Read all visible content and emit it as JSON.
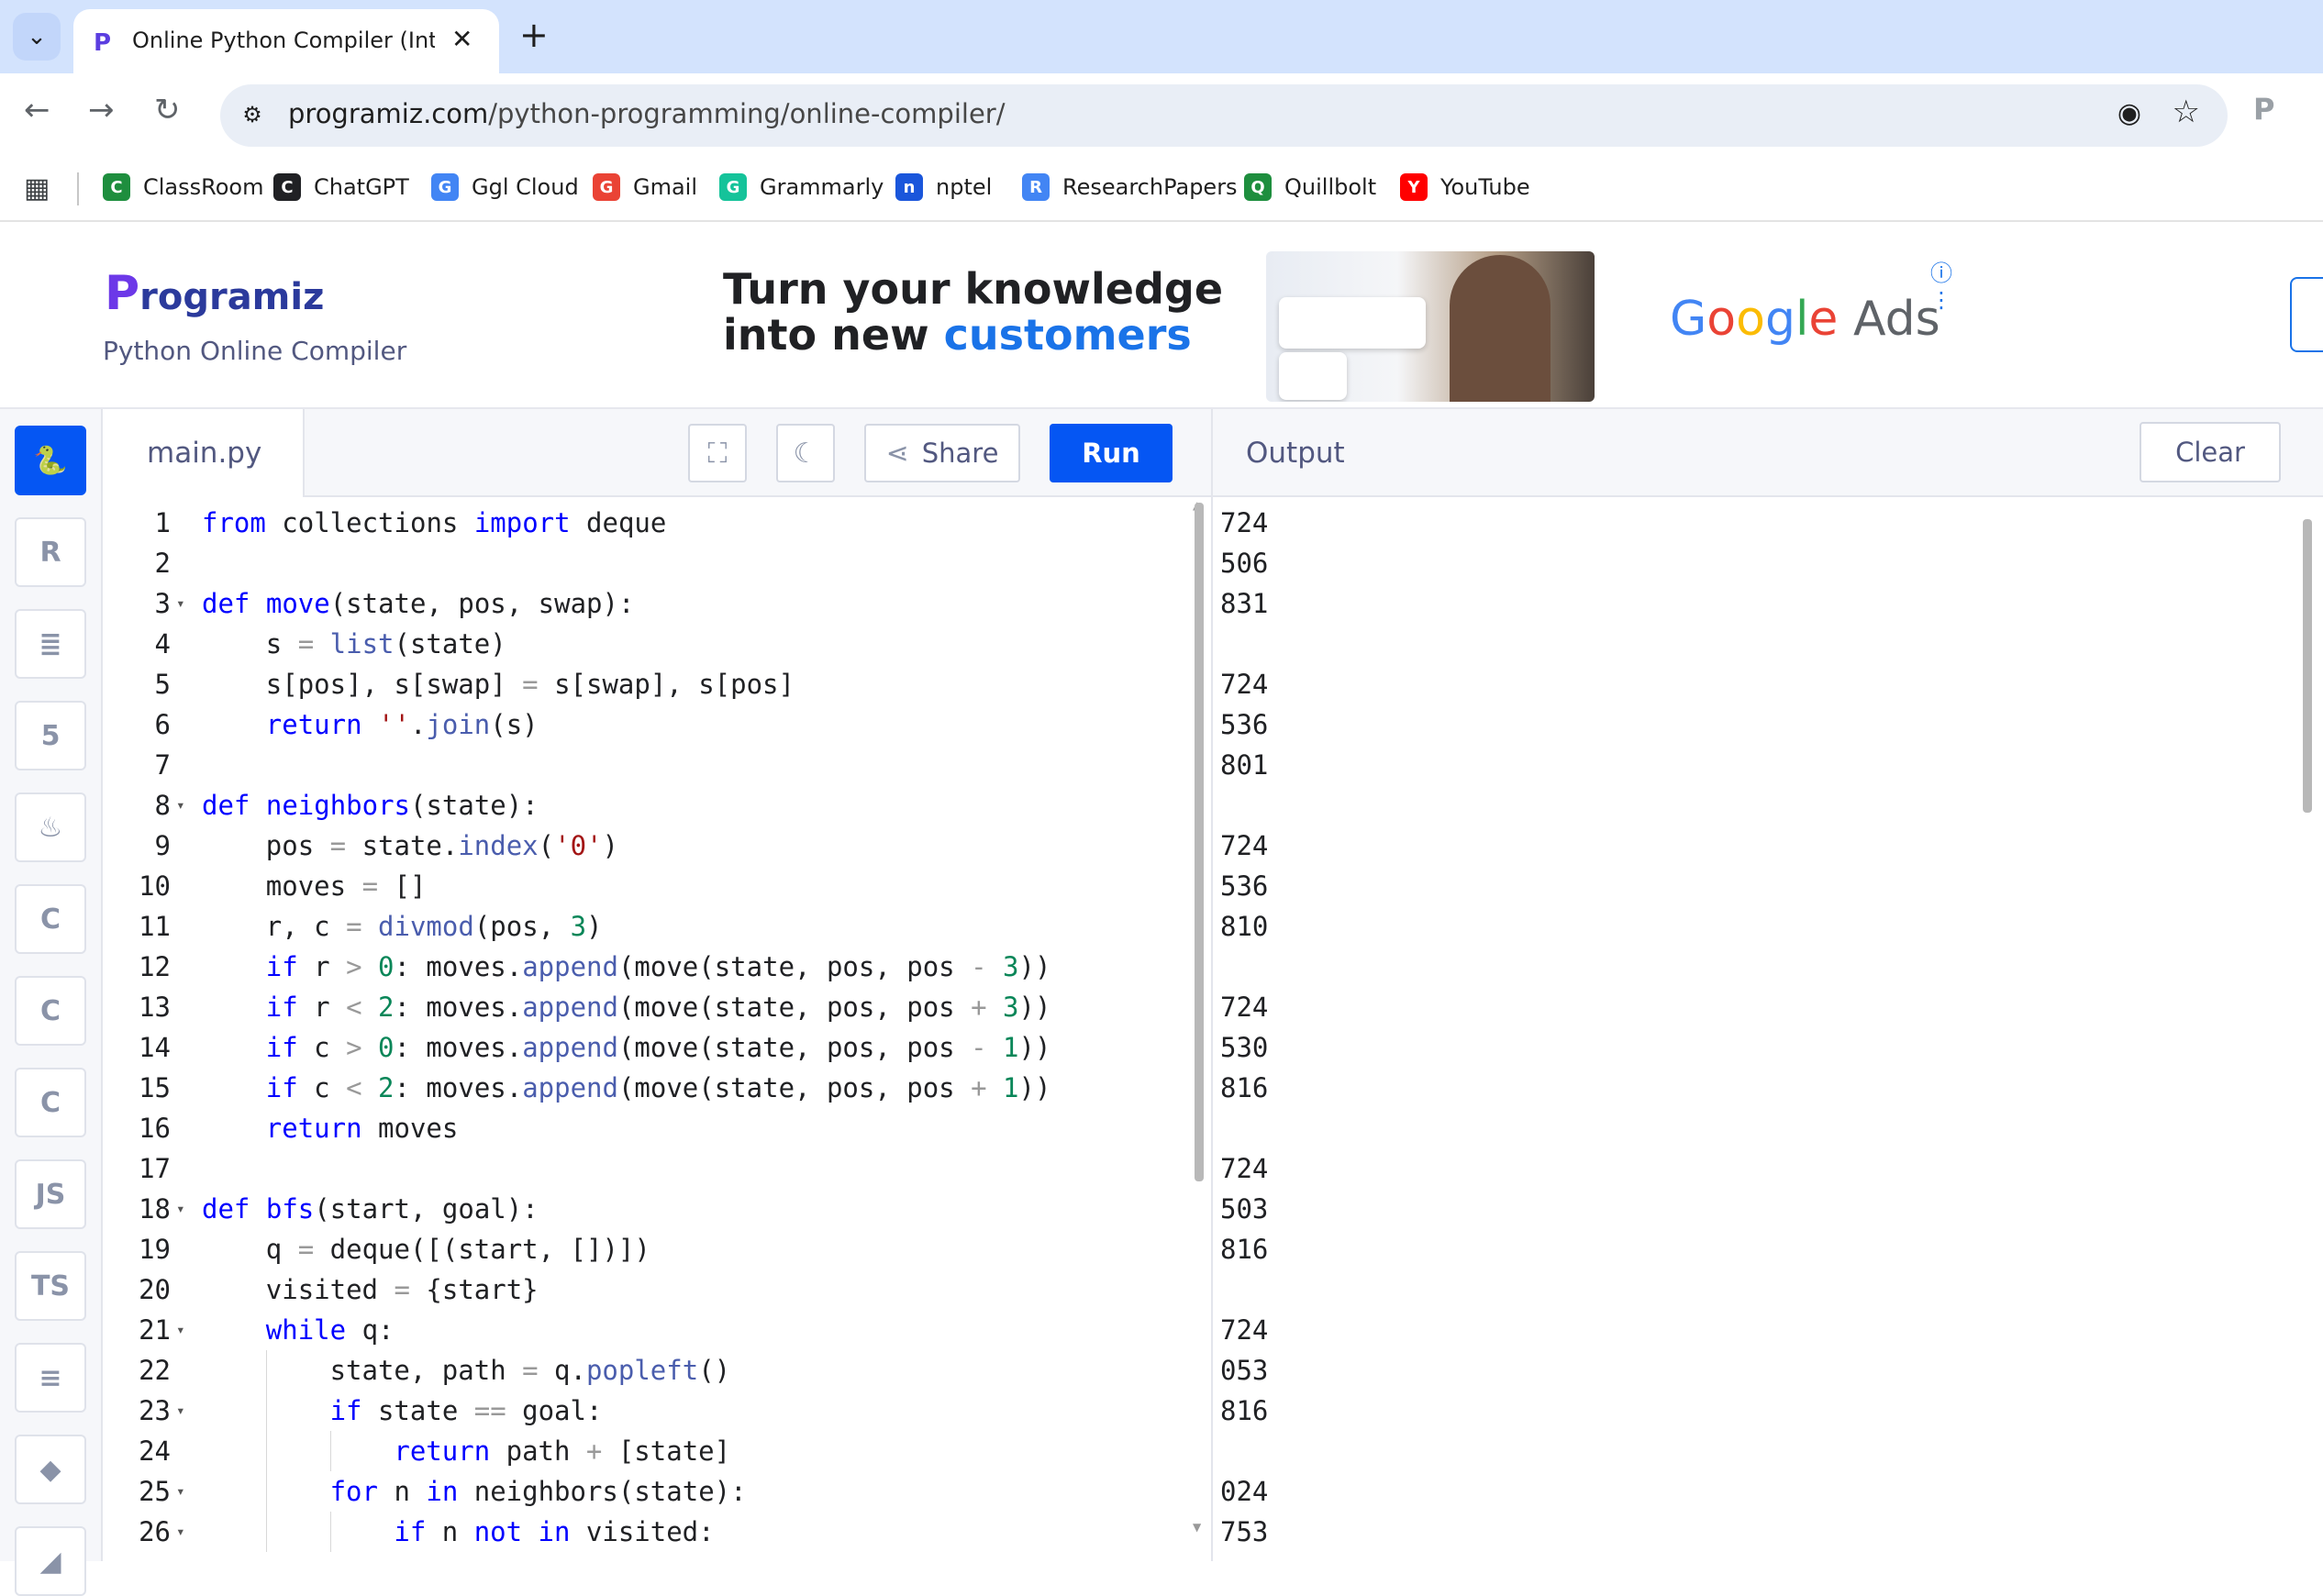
{
  "browser": {
    "tab_title": "Online Python Compiler (Interp",
    "url_host": "programiz.com",
    "url_path": "/python-programming/online-compiler/",
    "bookmarks": [
      {
        "label": "ClassRoom",
        "icon": "classroom-icon",
        "color": "#1e8e3e"
      },
      {
        "label": "ChatGPT",
        "icon": "chatgpt-icon",
        "color": "#202124"
      },
      {
        "label": "Ggl Cloud",
        "icon": "google-cloud-icon",
        "color": "#4285f4"
      },
      {
        "label": "Gmail",
        "icon": "gmail-icon",
        "color": "#ea4335"
      },
      {
        "label": "Grammarly",
        "icon": "grammarly-icon",
        "color": "#15c39a"
      },
      {
        "label": "nptel",
        "icon": "nptel-icon",
        "color": "#1a56db"
      },
      {
        "label": "ResearchPapers",
        "icon": "docs-icon",
        "color": "#4285f4"
      },
      {
        "label": "Quillbolt",
        "icon": "quillbot-icon",
        "color": "#1e8e3e"
      },
      {
        "label": "YouTube",
        "icon": "youtube-icon",
        "color": "#ff0000"
      }
    ]
  },
  "header": {
    "logo_text": "rogramiz",
    "logo_initial": "P",
    "subtitle": "Python Online Compiler"
  },
  "ad": {
    "line1": "Turn your knowledge",
    "line2_prefix": "into new ",
    "line2_highlight": "customers",
    "brand": [
      "G",
      "o",
      "o",
      "g",
      "l",
      "e"
    ],
    "brand_suffix": " Ads"
  },
  "rail": [
    {
      "name": "python",
      "glyph": "🐍"
    },
    {
      "name": "r",
      "glyph": "R"
    },
    {
      "name": "sql",
      "glyph": "≣"
    },
    {
      "name": "html",
      "glyph": "5"
    },
    {
      "name": "java",
      "glyph": "♨"
    },
    {
      "name": "c",
      "glyph": "C"
    },
    {
      "name": "cpp",
      "glyph": "C"
    },
    {
      "name": "csharp",
      "glyph": "C"
    },
    {
      "name": "js",
      "glyph": "JS"
    },
    {
      "name": "ts",
      "glyph": "TS"
    },
    {
      "name": "go",
      "glyph": "≡"
    },
    {
      "name": "swift",
      "glyph": "◆"
    },
    {
      "name": "more",
      "glyph": "◢"
    }
  ],
  "editor": {
    "file_name": "main.py",
    "share_label": "Share",
    "run_label": "Run",
    "lines": [
      {
        "n": "1",
        "fold": "",
        "indent": 0,
        "html": "<span class='kw'>from</span> collections <span class='kw'>import</span> deque"
      },
      {
        "n": "2",
        "fold": "",
        "indent": 0,
        "html": ""
      },
      {
        "n": "3",
        "fold": "▾",
        "indent": 0,
        "html": "<span class='kw'>def</span> <span class='fn'>move</span>(state, pos, swap):"
      },
      {
        "n": "4",
        "fold": "",
        "indent": 1,
        "html": "s <span class='op'>=</span> <span class='bi'>list</span>(state)"
      },
      {
        "n": "5",
        "fold": "",
        "indent": 1,
        "html": "s[pos], s[swap] <span class='op'>=</span> s[swap], s[pos]"
      },
      {
        "n": "6",
        "fold": "",
        "indent": 1,
        "html": "<span class='kw'>return</span> <span class='str'>''</span>.<span class='bi'>join</span>(s)"
      },
      {
        "n": "7",
        "fold": "",
        "indent": 0,
        "html": ""
      },
      {
        "n": "8",
        "fold": "▾",
        "indent": 0,
        "html": "<span class='kw'>def</span> <span class='fn'>neighbors</span>(state):"
      },
      {
        "n": "9",
        "fold": "",
        "indent": 1,
        "html": "pos <span class='op'>=</span> state.<span class='bi'>index</span>(<span class='str'>'0'</span>)"
      },
      {
        "n": "10",
        "fold": "",
        "indent": 1,
        "html": "moves <span class='op'>=</span> []"
      },
      {
        "n": "11",
        "fold": "",
        "indent": 1,
        "html": "r, c <span class='op'>=</span> <span class='bi'>divmod</span>(pos, <span class='num'>3</span>)"
      },
      {
        "n": "12",
        "fold": "",
        "indent": 1,
        "html": "<span class='kw'>if</span> r <span class='op'>&gt;</span> <span class='num'>0</span>: moves.<span class='bi'>append</span>(move(state, pos, pos <span class='op'>-</span> <span class='num'>3</span>))"
      },
      {
        "n": "13",
        "fold": "",
        "indent": 1,
        "html": "<span class='kw'>if</span> r <span class='op'>&lt;</span> <span class='num'>2</span>: moves.<span class='bi'>append</span>(move(state, pos, pos <span class='op'>+</span> <span class='num'>3</span>))"
      },
      {
        "n": "14",
        "fold": "",
        "indent": 1,
        "html": "<span class='kw'>if</span> c <span class='op'>&gt;</span> <span class='num'>0</span>: moves.<span class='bi'>append</span>(move(state, pos, pos <span class='op'>-</span> <span class='num'>1</span>))"
      },
      {
        "n": "15",
        "fold": "",
        "indent": 1,
        "html": "<span class='kw'>if</span> c <span class='op'>&lt;</span> <span class='num'>2</span>: moves.<span class='bi'>append</span>(move(state, pos, pos <span class='op'>+</span> <span class='num'>1</span>))"
      },
      {
        "n": "16",
        "fold": "",
        "indent": 1,
        "html": "<span class='kw'>return</span> moves"
      },
      {
        "n": "17",
        "fold": "",
        "indent": 0,
        "html": ""
      },
      {
        "n": "18",
        "fold": "▾",
        "indent": 0,
        "html": "<span class='kw'>def</span> <span class='fn'>bfs</span>(start, goal):"
      },
      {
        "n": "19",
        "fold": "",
        "indent": 1,
        "html": "q <span class='op'>=</span> deque([(start, [])])"
      },
      {
        "n": "20",
        "fold": "",
        "indent": 1,
        "html": "visited <span class='op'>=</span> {start}"
      },
      {
        "n": "21",
        "fold": "▾",
        "indent": 1,
        "html": "<span class='kw'>while</span> q:"
      },
      {
        "n": "22",
        "fold": "",
        "indent": 2,
        "html": "state, path <span class='op'>=</span> q.<span class='bi'>popleft</span>()"
      },
      {
        "n": "23",
        "fold": "▾",
        "indent": 2,
        "html": "<span class='kw'>if</span> state <span class='op'>==</span> goal:"
      },
      {
        "n": "24",
        "fold": "",
        "indent": 3,
        "html": "<span class='kw'>return</span> path <span class='op'>+</span> [state]"
      },
      {
        "n": "25",
        "fold": "▾",
        "indent": 2,
        "html": "<span class='kw'>for</span> n <span class='kw'>in</span> neighbors(state):"
      },
      {
        "n": "26",
        "fold": "▾",
        "indent": 3,
        "html": "<span class='kw'>if</span> n <span class='kw'>not in</span> visited:"
      }
    ]
  },
  "output": {
    "title": "Output",
    "clear_label": "Clear",
    "lines": [
      "724",
      "506",
      "831",
      "",
      "724",
      "536",
      "801",
      "",
      "724",
      "536",
      "810",
      "",
      "724",
      "530",
      "816",
      "",
      "724",
      "503",
      "816",
      "",
      "724",
      "053",
      "816",
      "",
      "024",
      "753"
    ]
  },
  "colors": {
    "keyword": "#0000ff",
    "function": "#0000ff",
    "builtin": "#4a5dad",
    "string": "#a31515",
    "number": "#098658",
    "accent": "#0556f3"
  }
}
